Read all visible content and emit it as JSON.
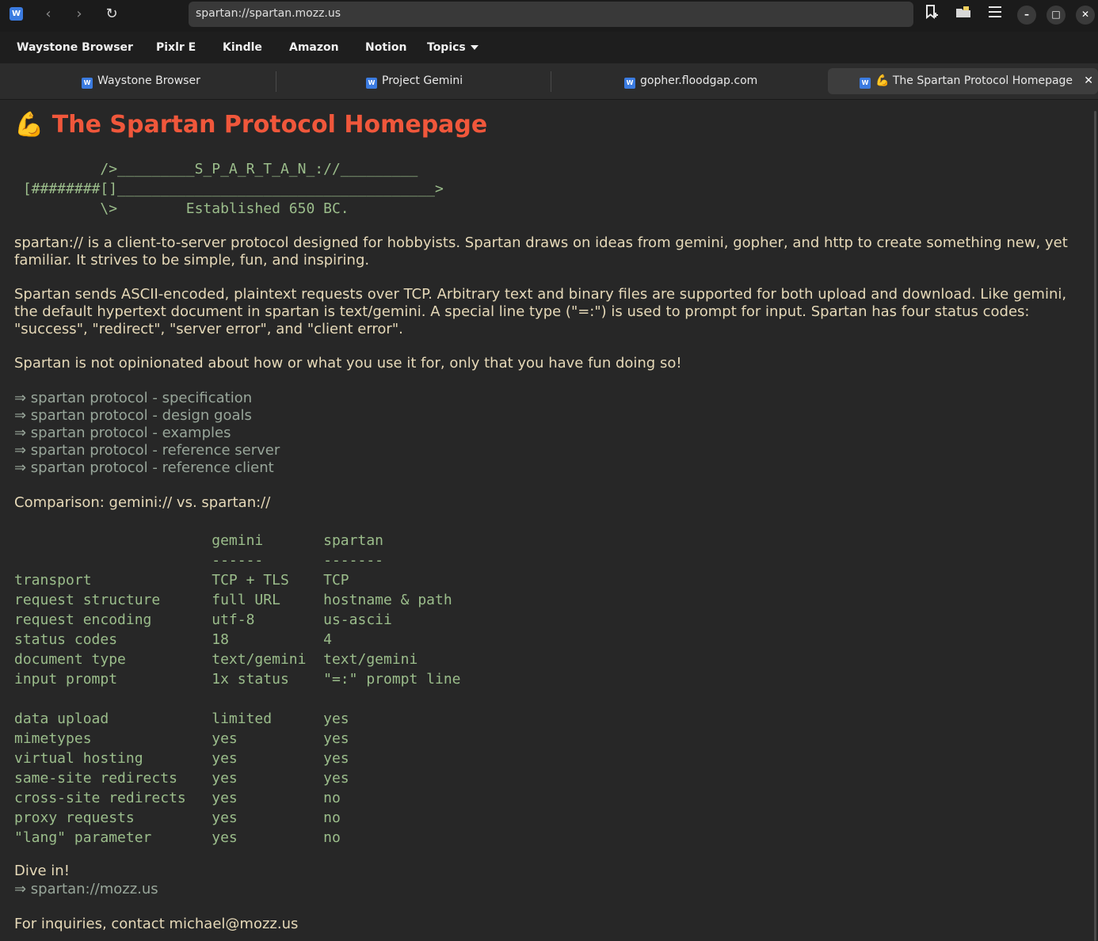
{
  "browser": {
    "url": "spartan://spartan.mozz.us",
    "app_logo": "W",
    "icons": {
      "back": "back-arrow-icon",
      "forward": "forward-arrow-icon",
      "reload": "reload-icon",
      "bookmark_add": "bookmark-add-icon",
      "folder": "folder-icon",
      "menu": "hamburger-menu-icon",
      "minimize": "minimize-icon",
      "maximize": "maximize-icon",
      "close": "close-icon"
    }
  },
  "bookmarks": [
    {
      "label": "Waystone Browser"
    },
    {
      "label": "Pixlr E"
    },
    {
      "label": "Kindle"
    },
    {
      "label": "Amazon"
    },
    {
      "label": "Notion"
    },
    {
      "label": "Topics"
    }
  ],
  "tabs": [
    {
      "label": "Waystone Browser",
      "active": false
    },
    {
      "label": "Project Gemini",
      "active": false
    },
    {
      "label": "gopher.floodgap.com",
      "active": false
    },
    {
      "label": "💪 The Spartan Protocol Homepage",
      "active": true
    }
  ],
  "page": {
    "title": "💪 The Spartan Protocol Homepage",
    "ascii_art": "          />_________S_P_A_R_T_A_N_://_________\n [########[]_____________________________________>\n          \\>        Established 650 BC.",
    "paragraph1": "spartan:// is a client-to-server protocol designed for hobbyists. Spartan draws on ideas from gemini, gopher, and http to create something new, yet familiar. It strives to be simple, fun, and inspiring.",
    "paragraph2": "Spartan sends ASCII-encoded, plaintext requests over TCP. Arbitrary text and binary files are supported for both upload and download. Like gemini, the default hypertext document in spartan is text/gemini. A special line type (\"=:\") is used to prompt for input. Spartan has four status codes: \"success\", \"redirect\", \"server error\", and \"client error\".",
    "paragraph3": "Spartan is not opinionated about how or what you use it for, only that you have fun doing so!",
    "links": [
      "⇒ spartan protocol - specification",
      "⇒ spartan protocol - design goals",
      "⇒ spartan protocol - examples",
      "⇒ spartan protocol - reference server",
      "⇒ spartan protocol - reference client"
    ],
    "comparison_heading": "Comparison: gemini:// vs. spartan://",
    "comparison_table": "                       gemini       spartan\n                       ------       -------\ntransport              TCP + TLS    TCP\nrequest structure      full URL     hostname & path\nrequest encoding       utf-8        us-ascii\nstatus codes           18           4\ndocument type          text/gemini  text/gemini\ninput prompt           1x status    \"=:\" prompt line\n\ndata upload            limited      yes\nmimetypes              yes          yes\nvirtual hosting        yes          yes\nsame-site redirects    yes          yes\ncross-site redirects   yes          no\nproxy requests         yes          no\n\"lang\" parameter       yes          no",
    "dive_in": "Dive in!",
    "dive_link": "⇒ spartan://mozz.us",
    "contact": "For inquiries, contact michael@mozz.us"
  }
}
